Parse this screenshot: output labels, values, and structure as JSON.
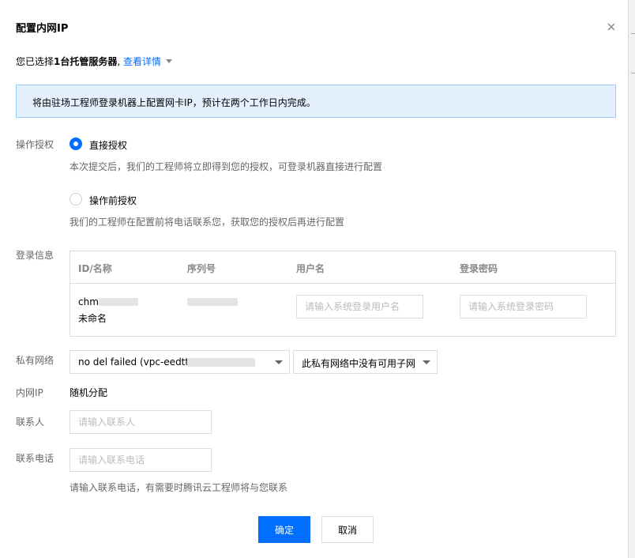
{
  "dialog": {
    "title": "配置内网IP",
    "close_icon": "close-icon"
  },
  "selection": {
    "prefix": "您已选择",
    "count": "1台托管服务器",
    "comma": ", ",
    "details_link": "查看详情"
  },
  "notice": {
    "text": "将由驻场工程师登录机器上配置网卡IP，预计在两个工作日内完成。",
    "background": "#e5f0ff",
    "border": "#97c7ff"
  },
  "authorization": {
    "label": "操作授权",
    "options": [
      {
        "label": "直接授权",
        "hint": "本次提交后，我们的工程师将立即得到您的授权，可登录机器直接进行配置",
        "checked": true
      },
      {
        "label": "操作前授权",
        "hint": "我们的工程师在配置前将电话联系您，获取您的授权后再进行配置",
        "checked": false
      }
    ]
  },
  "login_info": {
    "label": "登录信息",
    "columns": [
      "ID/名称",
      "序列号",
      "用户名",
      "登录密码"
    ],
    "row": {
      "id_prefix": "chm",
      "name": "未命名",
      "username_placeholder": "请输入系统登录用户名",
      "password_placeholder": "请输入系统登录密码"
    }
  },
  "private_network": {
    "label": "私有网络",
    "vpc_select_value": "no del failed (vpc-eedtt5",
    "subnet_select_value": "此私有网络中没有可用子网"
  },
  "private_ip": {
    "label": "内网IP",
    "value": "随机分配"
  },
  "contact": {
    "label": "联系人",
    "placeholder": "请输入联系人"
  },
  "phone": {
    "label": "联系电话",
    "placeholder": "请输入联系电话",
    "hint": "请输入联系电话，有需要时腾讯云工程师将与您联系"
  },
  "footer": {
    "confirm_label": "确定",
    "cancel_label": "取消"
  },
  "colors": {
    "accent": "#006eff",
    "text_secondary": "#666666",
    "border": "#dddddd"
  }
}
